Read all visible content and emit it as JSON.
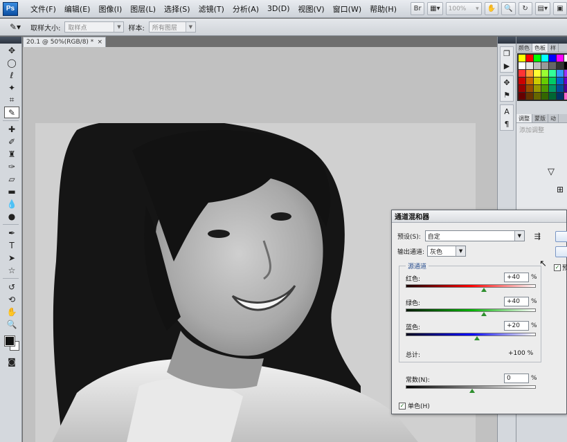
{
  "app": {
    "logo": "Ps"
  },
  "menu": [
    "文件(F)",
    "编辑(E)",
    "图像(I)",
    "图层(L)",
    "选择(S)",
    "滤镜(T)",
    "分析(A)",
    "3D(D)",
    "视图(V)",
    "窗口(W)",
    "帮助(H)"
  ],
  "menubar_tools": {
    "zoom": "100%"
  },
  "options": {
    "sample_size_label": "取样大小:",
    "sample_size_value": "取样点",
    "sample_label": "样本:",
    "sample_value": "所有图层"
  },
  "document": {
    "tab_title": "20.1 @ 50%(RGB/8) *",
    "close": "×"
  },
  "panels": {
    "top_tabs": [
      "颜色",
      "色板",
      "样"
    ],
    "adjust_tabs": [
      "调整",
      "蒙版",
      "动"
    ],
    "adjust_hint": "添加调整",
    "swatches": [
      "#ffff00",
      "#ff0000",
      "#00ff00",
      "#00ffff",
      "#0000ff",
      "#ff00ff",
      "#ffffff",
      "#ffffff",
      "#e6e6e6",
      "#bfbfbf",
      "#999999",
      "#666666",
      "#333333",
      "#000000",
      "#ff3333",
      "#ff9933",
      "#ffff33",
      "#99ff33",
      "#33ff99",
      "#3399ff",
      "#9933ff",
      "#cc0000",
      "#cc6600",
      "#cccc00",
      "#66cc00",
      "#00cc66",
      "#0066cc",
      "#6600cc",
      "#990000",
      "#994d00",
      "#999900",
      "#4d9900",
      "#009966",
      "#004d99",
      "#4d0099",
      "#660000",
      "#663300",
      "#666600",
      "#336600",
      "#006633",
      "#003366",
      "#ff66cc"
    ]
  },
  "dialog": {
    "title": "通道混和器",
    "preset_label": "预设(S):",
    "preset_value": "自定",
    "output_label": "输出通道:",
    "output_value": "灰色",
    "source_group": "源通道",
    "channels": [
      {
        "label": "红色:",
        "value": "+40",
        "unit": "%",
        "pct": 40,
        "gradient": [
          "#1a0000",
          "#ff0000",
          "#ffffff"
        ]
      },
      {
        "label": "绿色:",
        "value": "+40",
        "unit": "%",
        "pct": 40,
        "gradient": [
          "#001a00",
          "#00b000",
          "#ffffff"
        ]
      },
      {
        "label": "蓝色:",
        "value": "+20",
        "unit": "%",
        "pct": 20,
        "gradient": [
          "#00001a",
          "#0000ff",
          "#ffffff"
        ]
      }
    ],
    "total_label": "总计:",
    "total_value": "+100 %",
    "constant_label": "常数(N):",
    "constant_value": "0",
    "constant_unit": "%",
    "mono_label": "单色(H)",
    "preview_label": "预"
  }
}
